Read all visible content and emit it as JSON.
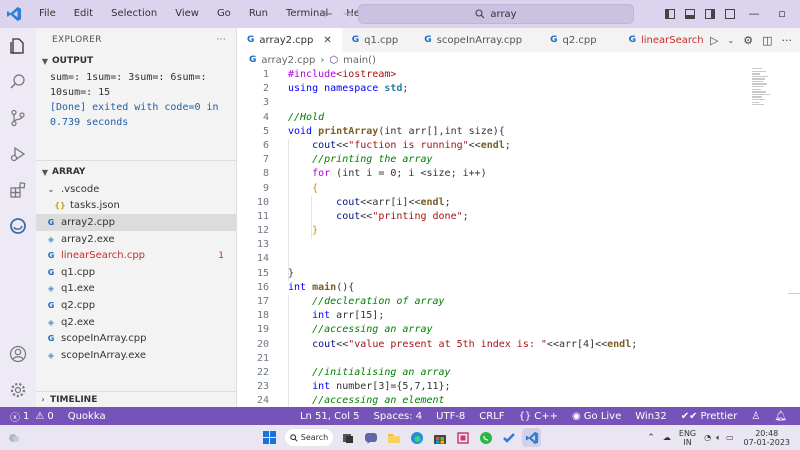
{
  "titlebar": {
    "menu": [
      "File",
      "Edit",
      "Selection",
      "View",
      "Go",
      "Run",
      "Terminal",
      "Help"
    ],
    "search_text": "array"
  },
  "explorer": {
    "title": "EXPLORER",
    "more": "···",
    "output_title": "OUTPUT",
    "output_lines": [
      "sum=: 1sum=: 3sum=: 6sum=:",
      "10sum=: 15",
      "[Done] exited with code=0 in",
      "0.739 seconds"
    ],
    "folder_title": "ARRAY",
    "timeline_title": "TIMELINE",
    "files": [
      {
        "name": ".vscode",
        "type": "folder"
      },
      {
        "name": "tasks.json",
        "type": "json"
      },
      {
        "name": "array2.cpp",
        "type": "cpp"
      },
      {
        "name": "array2.exe",
        "type": "exe"
      },
      {
        "name": "linearSearch.cpp",
        "type": "cpp",
        "errors": "1"
      },
      {
        "name": "q1.cpp",
        "type": "cpp"
      },
      {
        "name": "q1.exe",
        "type": "exe"
      },
      {
        "name": "q2.cpp",
        "type": "cpp"
      },
      {
        "name": "q2.exe",
        "type": "exe"
      },
      {
        "name": "scopeInArray.cpp",
        "type": "cpp"
      },
      {
        "name": "scopeInArray.exe",
        "type": "exe"
      }
    ]
  },
  "tabs": [
    {
      "label": "array2.cpp",
      "close": "✕"
    },
    {
      "label": "q1.cpp"
    },
    {
      "label": "scopeInArray.cpp"
    },
    {
      "label": "q2.cpp"
    },
    {
      "label": "linearSearch"
    }
  ],
  "breadcrumb": {
    "file": "array2.cpp",
    "separator": "›",
    "symbol": "main()"
  },
  "code": {
    "lines": [
      {
        "n": "1"
      },
      {
        "n": "2"
      },
      {
        "n": "3"
      },
      {
        "n": "4"
      },
      {
        "n": "5"
      },
      {
        "n": "6"
      },
      {
        "n": "7"
      },
      {
        "n": "8"
      },
      {
        "n": "9"
      },
      {
        "n": "10"
      },
      {
        "n": "11"
      },
      {
        "n": "12"
      },
      {
        "n": "13"
      },
      {
        "n": "14"
      },
      {
        "n": "15"
      },
      {
        "n": "16"
      },
      {
        "n": "17"
      },
      {
        "n": "18"
      },
      {
        "n": "19"
      },
      {
        "n": "20"
      },
      {
        "n": "21"
      },
      {
        "n": "22"
      },
      {
        "n": "23"
      },
      {
        "n": "24"
      }
    ],
    "tokens": {
      "include": "#include",
      "iostream": "<iostream>",
      "using": "using",
      "namespace": "namespace",
      "std": "std",
      "semi": ";",
      "c_hold": "//Hold",
      "void": "void",
      "printArray": "printArray",
      "sig": "(int arr[],int size){",
      "cout": "cout",
      "shl": "<<",
      "s_fuction": "\"fuction is running\"",
      "endl": "endl",
      "c_printing": "//printing the array",
      "for": "for",
      "for_head": " (int i = 0; i <size; i++)",
      "lbrace": "{",
      "rbrace": "}",
      "arr_i": "arr[i]",
      "s_done": "\"printing done\"",
      "int": "int",
      "main": "main",
      "main_sig": "(){",
      "c_decl": "//decleration of array",
      "arr15": " arr[15];",
      "c_access": "//accessing an array",
      "s_value": "\"value present at 5th index is: \"",
      "arr4": "arr[4]",
      "c_init": "//initialising an array",
      "number_decl": " number[3]={5,7,11};",
      "c_elem": "//accessing an element"
    }
  },
  "statusbar": {
    "errors": "1",
    "warnings": "0",
    "extension": "Quokka",
    "position": "Ln 51, Col 5",
    "spaces": "Spaces: 4",
    "encoding": "UTF-8",
    "eol": "CRLF",
    "language": "C++",
    "golive": "Go Live",
    "platform": "Win32",
    "prettier": "Prettier"
  },
  "taskbar": {
    "search_label": "Search",
    "lang1": "ENG",
    "lang2": "IN",
    "time": "20:48",
    "date": "07-01-2023"
  },
  "colors": {
    "accent": "#7653b8",
    "titlebar": "#dcd4ee",
    "error": "#c72e2e"
  }
}
